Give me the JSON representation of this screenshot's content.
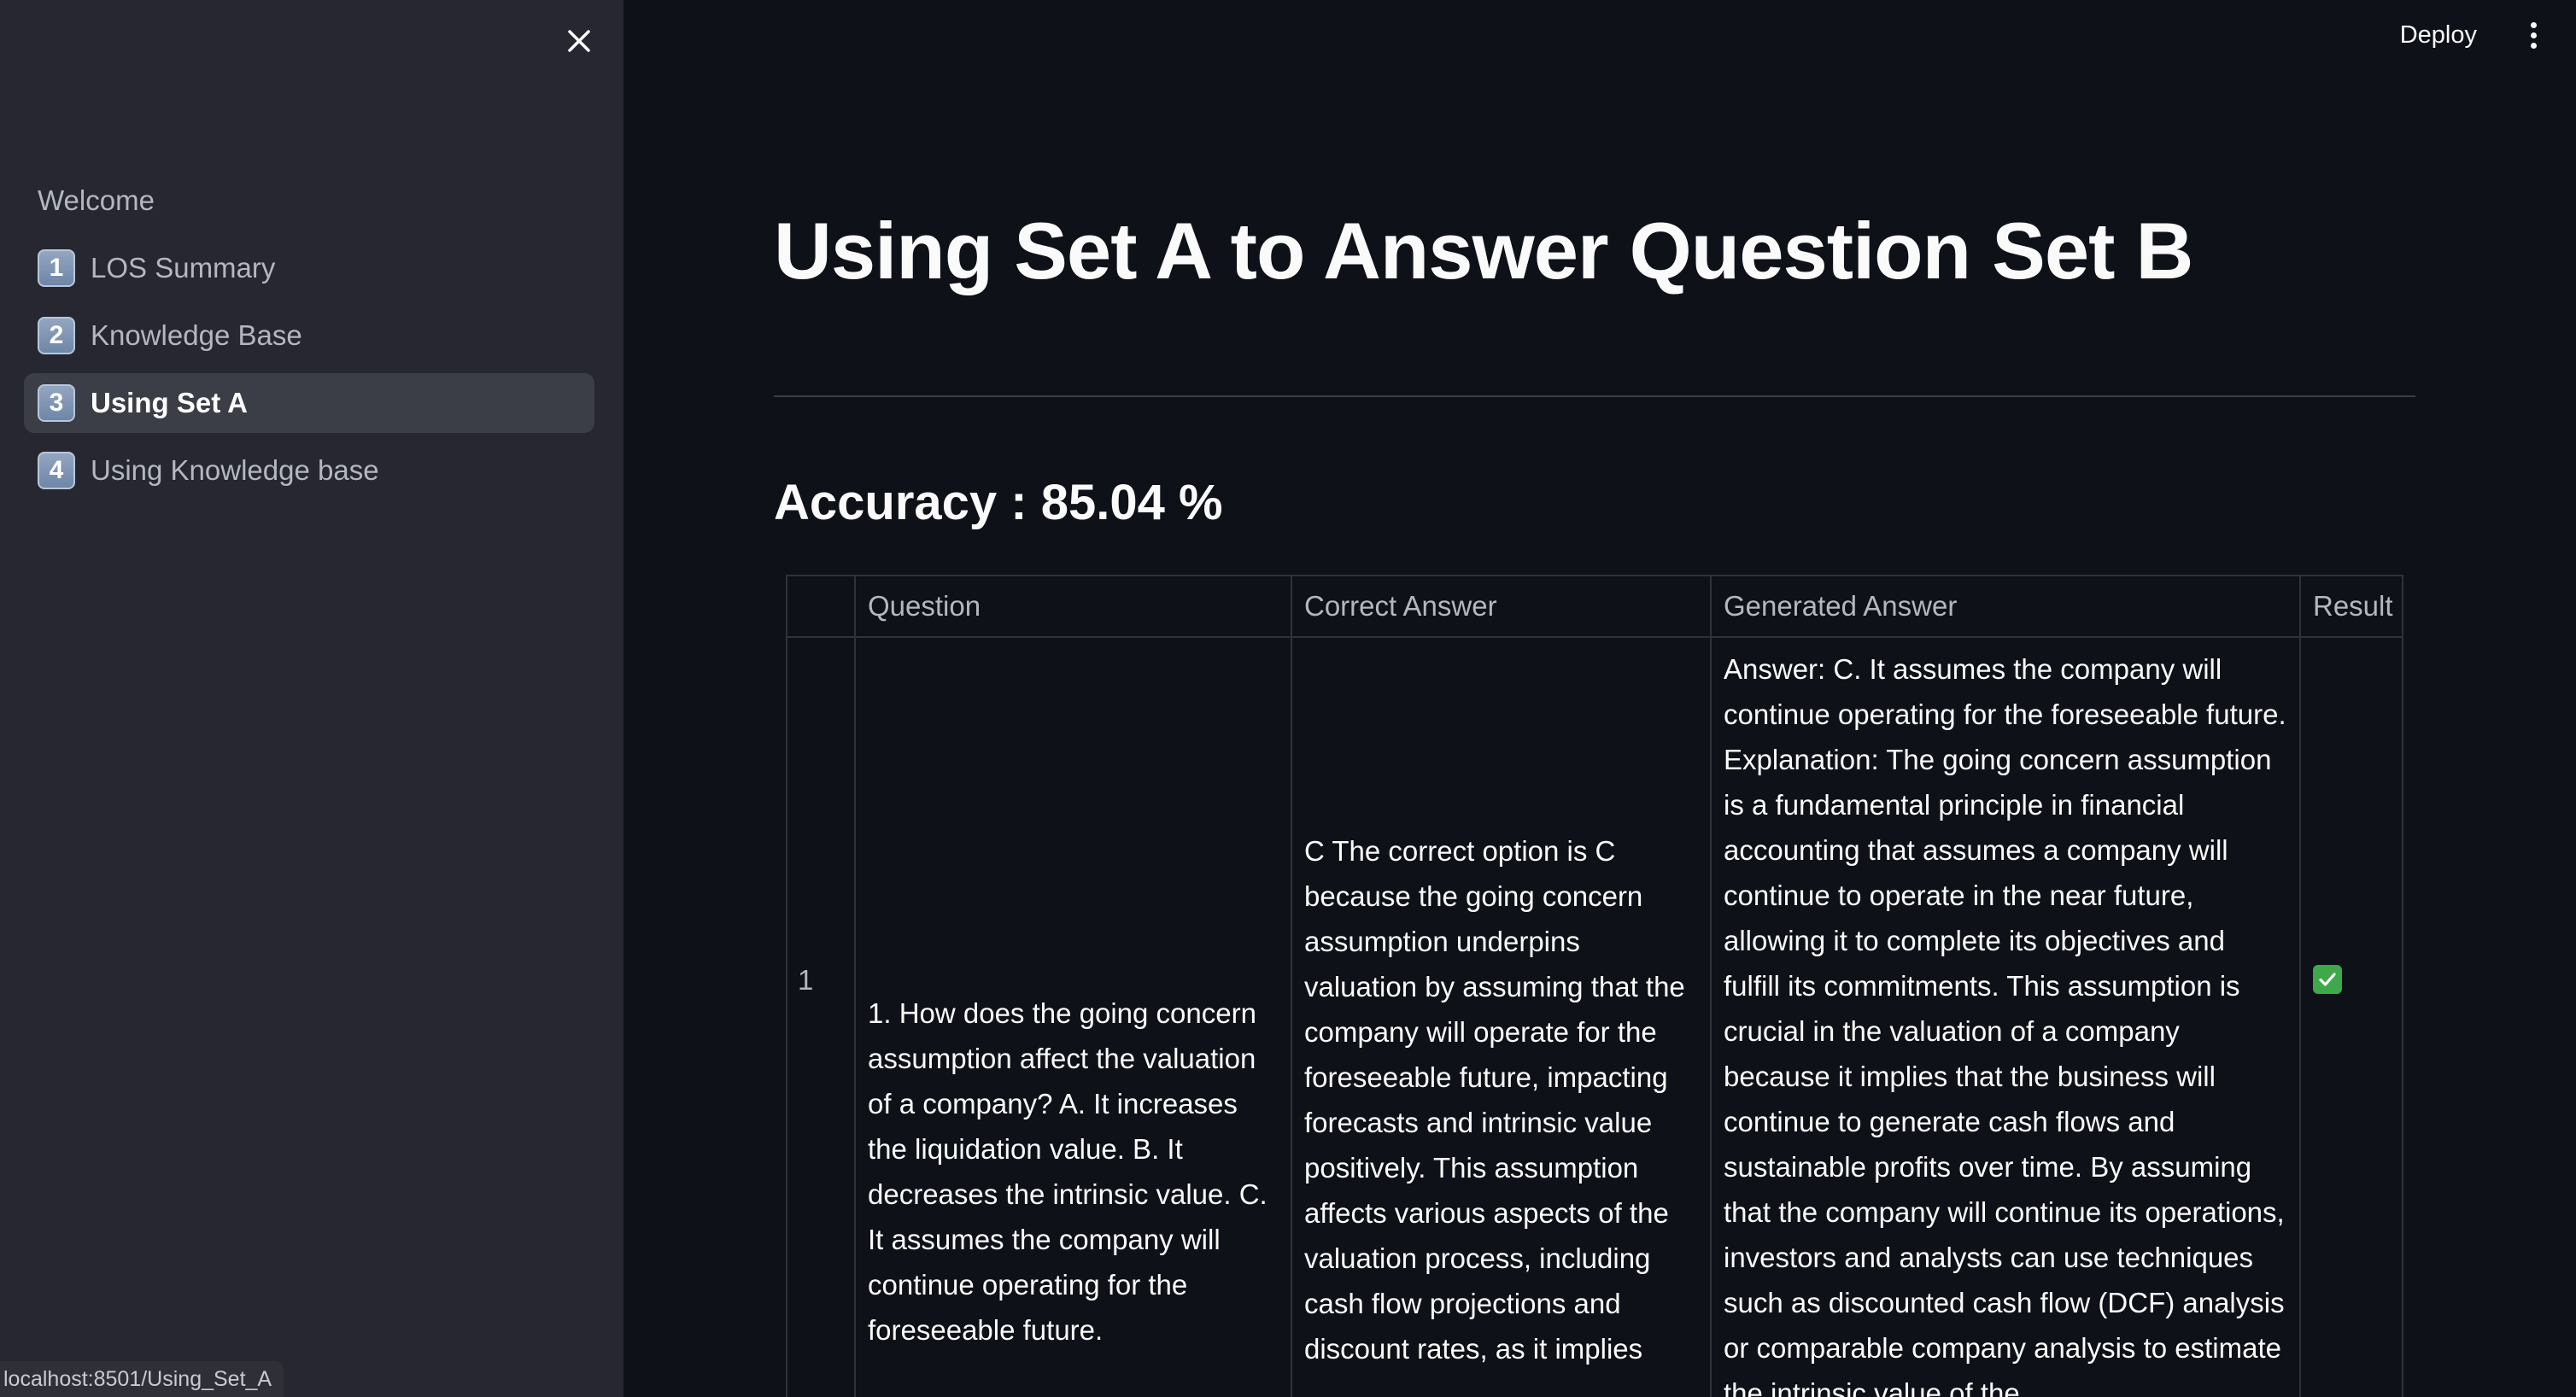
{
  "sidebar": {
    "items": [
      {
        "label": "Welcome",
        "badge": ""
      },
      {
        "label": "LOS Summary",
        "badge": "1"
      },
      {
        "label": "Knowledge Base",
        "badge": "2"
      },
      {
        "label": "Using Set A",
        "badge": "3"
      },
      {
        "label": "Using Knowledge base",
        "badge": "4"
      }
    ],
    "active_index": 3,
    "close_icon": "close-icon"
  },
  "status_bar": {
    "url": "localhost:8501/Using_Set_A"
  },
  "header": {
    "deploy_label": "Deploy",
    "menu_icon": "more-vertical-icon"
  },
  "main": {
    "title": "Using Set A to Answer Question Set B",
    "accuracy": "Accuracy : 85.04 %"
  },
  "table": {
    "columns": [
      "",
      "Question",
      "Correct Answer",
      "Generated Answer",
      "Result"
    ],
    "rows": [
      {
        "index": "1",
        "question": "1. How does the going concern assumption affect the valuation of a company? A. It increases the liquidation value. B. It decreases the intrinsic value. C. It assumes the company will continue operating for the foreseeable future.",
        "correct_answer": "C The correct option is C because the going concern assumption underpins valuation by assuming that the company will operate for the foreseeable future, impacting forecasts and intrinsic value positively. This assumption affects various aspects of the valuation process, including cash flow projections and discount rates, as it implies",
        "generated_answer": "Answer: C. It assumes the company will continue operating for the foreseeable future. Explanation: The going concern assumption is a fundamental principle in financial accounting that assumes a company will continue to operate in the near future, allowing it to complete its objectives and fulfill its commitments. This assumption is crucial in the valuation of a company because it implies that the business will continue to generate cash flows and sustainable profits over time. By assuming that the company will continue its operations, investors and analysts can use techniques such as discounted cash flow (DCF) analysis or comparable company analysis to estimate the intrinsic value of the",
        "result_icon": "check-mark-icon"
      }
    ]
  },
  "colors": {
    "background": "#0e1117",
    "sidebar": "#262730",
    "active_item": "#3b3d47",
    "result_check": "#3ea84a"
  }
}
